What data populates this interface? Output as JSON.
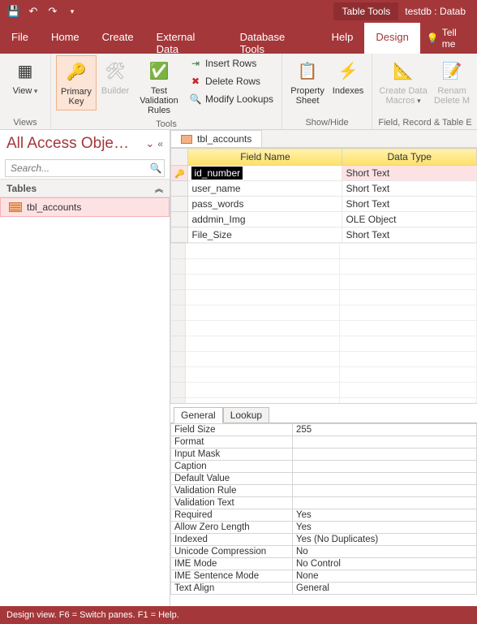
{
  "titlebar": {
    "tool_tab": "Table Tools",
    "db_name": "testdb : Datab"
  },
  "tabs": {
    "file": "File",
    "home": "Home",
    "create": "Create",
    "external": "External Data",
    "dbtools": "Database Tools",
    "help": "Help",
    "design": "Design",
    "tellme": "Tell me"
  },
  "ribbon": {
    "views_group": "Views",
    "tools_group": "Tools",
    "showhide_group": "Show/Hide",
    "events_group": "Field, Record & Table E",
    "view": "View",
    "primary_key": "Primary Key",
    "builder": "Builder",
    "test_validation": "Test Validation Rules",
    "insert_rows": "Insert Rows",
    "delete_rows": "Delete Rows",
    "modify_lookups": "Modify Lookups",
    "property_sheet": "Property Sheet",
    "indexes": "Indexes",
    "create_macros": "Create Data Macros",
    "rename_delete": "Renam Delete M"
  },
  "nav": {
    "title": "All Access Obje…",
    "search_placeholder": "Search...",
    "tables_label": "Tables",
    "items": [
      {
        "label": "tbl_accounts"
      }
    ]
  },
  "doc": {
    "tab_label": "tbl_accounts",
    "col_field": "Field Name",
    "col_type": "Data Type",
    "rows": [
      {
        "field": "id_number",
        "type": "Short Text",
        "pk": true,
        "selected": true
      },
      {
        "field": "user_name",
        "type": "Short Text",
        "pk": false,
        "selected": false
      },
      {
        "field": "pass_words",
        "type": "Short Text",
        "pk": false,
        "selected": false
      },
      {
        "field": "addmin_Img",
        "type": "OLE Object",
        "pk": false,
        "selected": false
      },
      {
        "field": "File_Size",
        "type": "Short Text",
        "pk": false,
        "selected": false
      }
    ]
  },
  "props": {
    "tab_general": "General",
    "tab_lookup": "Lookup",
    "rows": [
      {
        "label": "Field Size",
        "value": "255"
      },
      {
        "label": "Format",
        "value": ""
      },
      {
        "label": "Input Mask",
        "value": ""
      },
      {
        "label": "Caption",
        "value": ""
      },
      {
        "label": "Default Value",
        "value": ""
      },
      {
        "label": "Validation Rule",
        "value": ""
      },
      {
        "label": "Validation Text",
        "value": ""
      },
      {
        "label": "Required",
        "value": "Yes"
      },
      {
        "label": "Allow Zero Length",
        "value": "Yes"
      },
      {
        "label": "Indexed",
        "value": "Yes (No Duplicates)"
      },
      {
        "label": "Unicode Compression",
        "value": "No"
      },
      {
        "label": "IME Mode",
        "value": "No Control"
      },
      {
        "label": "IME Sentence Mode",
        "value": "None"
      },
      {
        "label": "Text Align",
        "value": "General"
      }
    ]
  },
  "status": {
    "text": "Design view.   F6 = Switch panes.   F1 = Help."
  }
}
